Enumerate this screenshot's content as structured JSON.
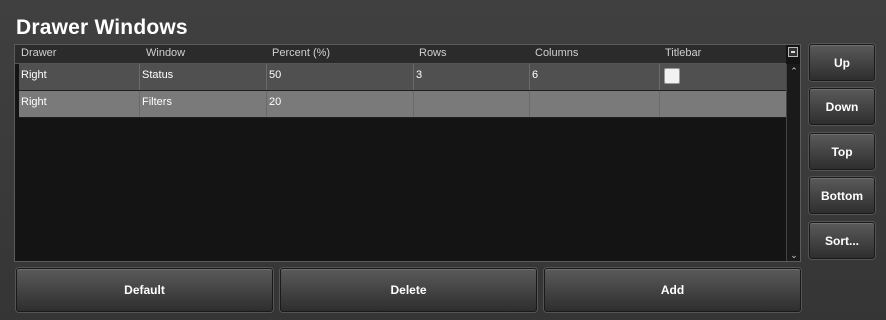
{
  "title": "Drawer Windows",
  "table": {
    "columns": [
      "Drawer",
      "Window",
      "Percent (%)",
      "Rows",
      "Columns",
      "Titlebar"
    ],
    "rows": [
      {
        "drawer": "Right",
        "window": "Status",
        "percent": "50",
        "rows": "3",
        "columns": "6",
        "titlebar_checked": false
      },
      {
        "drawer": "Right",
        "window": "Filters",
        "percent": "20",
        "rows": "",
        "columns": "",
        "titlebar_checked": null
      }
    ]
  },
  "side_buttons": {
    "up": "Up",
    "down": "Down",
    "top": "Top",
    "bottom": "Bottom",
    "sort": "Sort..."
  },
  "bottom_buttons": {
    "default": "Default",
    "delete": "Delete",
    "add": "Add"
  }
}
